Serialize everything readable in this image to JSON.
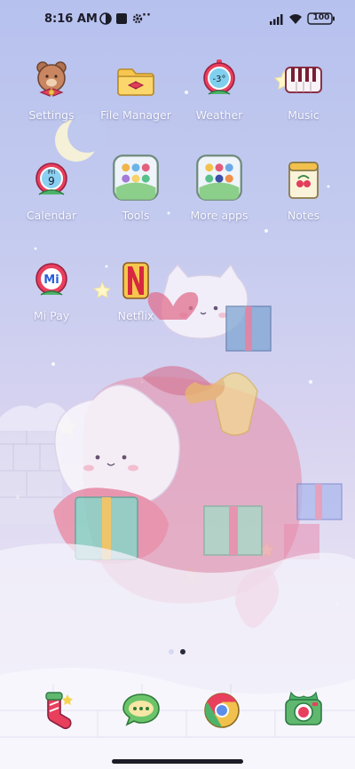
{
  "status": {
    "time": "8:16 AM",
    "battery": "100",
    "overflow": "··"
  },
  "apps": [
    {
      "label": "Settings",
      "icon": "settings-bear-icon"
    },
    {
      "label": "File Manager",
      "icon": "folder-icon"
    },
    {
      "label": "Weather",
      "icon": "weather-thermometer-icon",
      "badge": "-3°"
    },
    {
      "label": "Music",
      "icon": "piano-keys-icon"
    },
    {
      "label": "Calendar",
      "icon": "calendar-icon",
      "badge_day": "Fri",
      "badge_date": "9"
    },
    {
      "label": "Tools",
      "icon": "folder-grid-icon"
    },
    {
      "label": "More apps",
      "icon": "folder-grid-icon"
    },
    {
      "label": "Notes",
      "icon": "notes-icon"
    },
    {
      "label": "Mi Pay",
      "icon": "mi-pay-icon",
      "badge": "Mi"
    },
    {
      "label": "Netflix",
      "icon": "netflix-icon"
    }
  ],
  "dock": [
    {
      "icon": "phone-stocking-icon"
    },
    {
      "icon": "messages-bubble-icon"
    },
    {
      "icon": "chrome-icon"
    },
    {
      "icon": "camera-icon"
    }
  ],
  "pages": {
    "count": 2,
    "active": 2
  },
  "colors": {
    "label_text": "#f7f8ff",
    "status_text": "#1c1c28",
    "dot_active": "#2a2a3a",
    "dot_inactive": "#d6d9f2"
  }
}
